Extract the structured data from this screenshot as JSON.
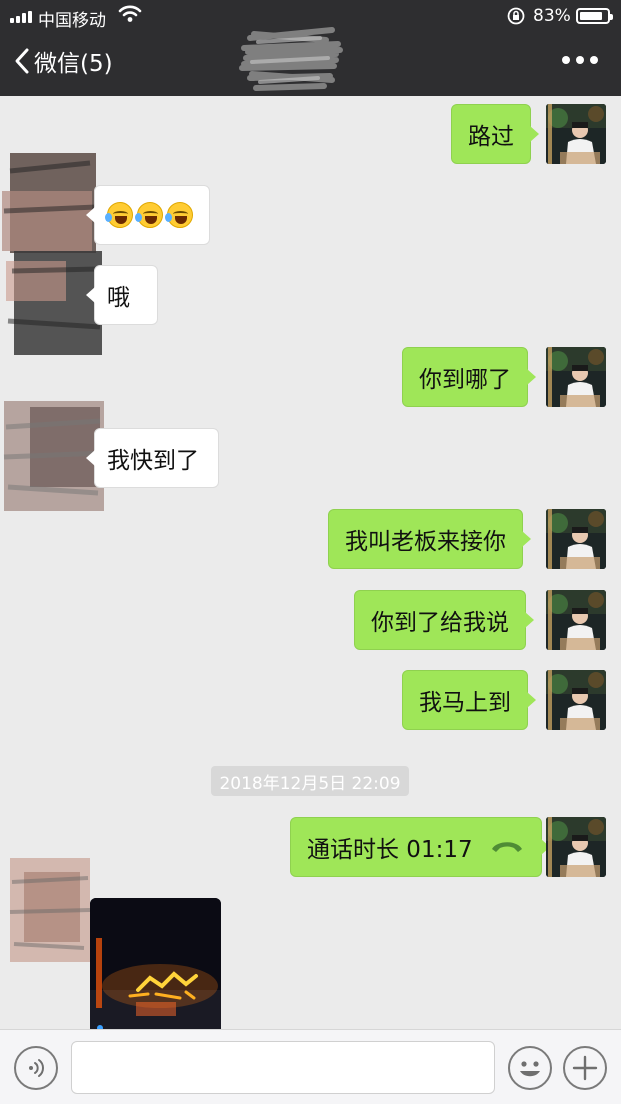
{
  "status_bar": {
    "carrier": "中国移动",
    "battery_percent": "83%",
    "battery_level": 0.83
  },
  "nav": {
    "back_label": "微信(5)"
  },
  "messages": [
    {
      "side": "out",
      "text": "路过"
    },
    {
      "side": "in",
      "text": "",
      "emoji": "face-with-tears-of-joy",
      "emoji_count": 3
    },
    {
      "side": "in",
      "text": "哦"
    },
    {
      "side": "out",
      "text": "你到哪了"
    },
    {
      "side": "in",
      "text": "我快到了"
    },
    {
      "side": "out",
      "text": "我叫老板来接你"
    },
    {
      "side": "out",
      "text": "你到了给我说"
    },
    {
      "side": "out",
      "text": "我马上到"
    },
    {
      "side": "out",
      "type": "call",
      "text": "通话时长 01:17"
    },
    {
      "side": "in",
      "type": "image"
    }
  ],
  "timestamp": "2018年12月5日 22:09",
  "input_bar": {
    "text_value": ""
  },
  "colors": {
    "header_bg": "#2e2e30",
    "chat_bg": "#ebebeb",
    "outgoing_bubble": "#9fe658",
    "incoming_bubble": "#ffffff"
  }
}
